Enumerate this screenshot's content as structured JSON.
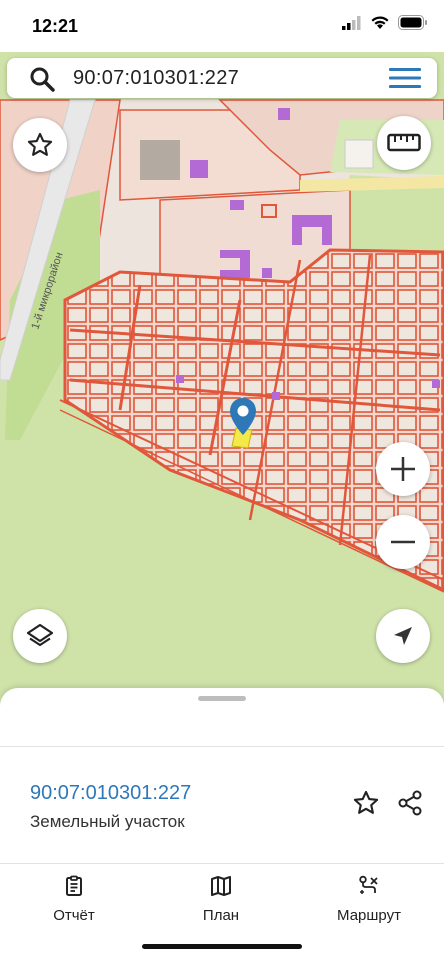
{
  "status": {
    "time": "12:21"
  },
  "search": {
    "query": "90:07:010301:227"
  },
  "map": {
    "road_label": "1-й микрорайон"
  },
  "parcel": {
    "id": "90:07:010301:227",
    "type": "Земельный участок"
  },
  "tabs": [
    {
      "label": "Отчёт",
      "icon": "report-icon"
    },
    {
      "label": "План",
      "icon": "map-plan-icon"
    },
    {
      "label": "Маршрут",
      "icon": "route-icon"
    }
  ],
  "colors": {
    "accent": "#2f78b8",
    "parcel_line": "#e0573b",
    "land": "#cfe3a9",
    "selected": "#f4e84b",
    "building": "#b46ad4"
  }
}
